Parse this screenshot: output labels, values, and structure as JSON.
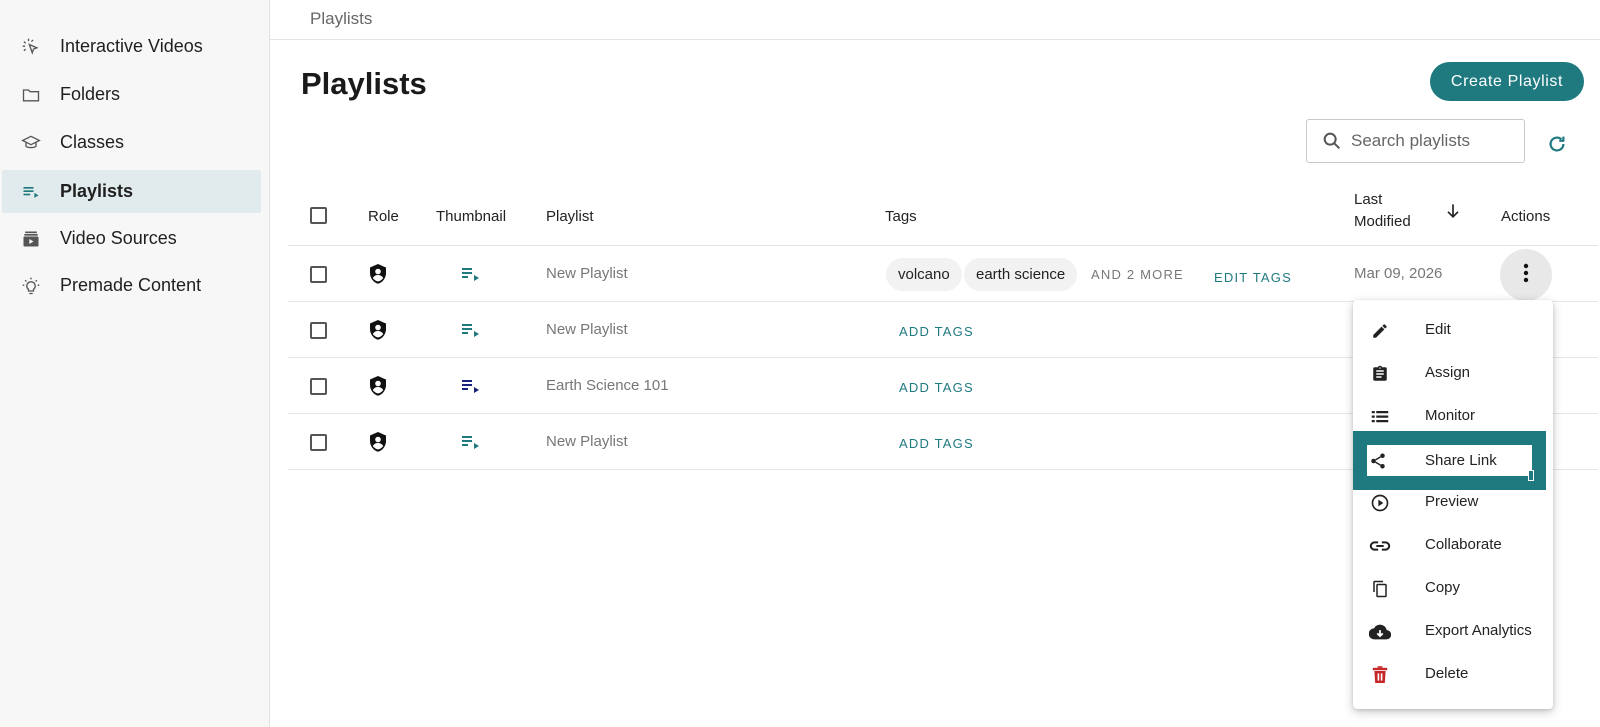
{
  "sidebar": {
    "items": [
      {
        "label": "Interactive Videos",
        "icon": "cursor-click-icon"
      },
      {
        "label": "Folders",
        "icon": "folder-icon"
      },
      {
        "label": "Classes",
        "icon": "graduation-cap-icon"
      },
      {
        "label": "Playlists",
        "icon": "playlist-icon",
        "active": true
      },
      {
        "label": "Video Sources",
        "icon": "video-library-icon"
      },
      {
        "label": "Premade Content",
        "icon": "lightbulb-icon"
      }
    ]
  },
  "breadcrumb": "Playlists",
  "page_title": "Playlists",
  "create_button": "Create Playlist",
  "search": {
    "placeholder": "Search playlists"
  },
  "table": {
    "headers": {
      "role": "Role",
      "thumbnail": "Thumbnail",
      "playlist": "Playlist",
      "tags": "Tags",
      "last_modified_1": "Last",
      "last_modified_2": "Modified",
      "actions": "Actions"
    },
    "rows": [
      {
        "name": "New Playlist",
        "tags": [
          "volcano",
          "earth science"
        ],
        "more": "AND 2 MORE",
        "tag_action": "EDIT TAGS",
        "modified": "Mar 09, 2026"
      },
      {
        "name": "New Playlist",
        "tag_action": "ADD TAGS"
      },
      {
        "name": "Earth Science 101",
        "tag_action": "ADD TAGS"
      },
      {
        "name": "New Playlist",
        "tag_action": "ADD TAGS"
      }
    ]
  },
  "menu": {
    "items": [
      {
        "label": "Edit",
        "icon": "pencil-icon"
      },
      {
        "label": "Assign",
        "icon": "clipboard-icon"
      },
      {
        "label": "Monitor",
        "icon": "list-icon"
      },
      {
        "label": "Share Link",
        "icon": "share-icon"
      },
      {
        "label": "Preview",
        "icon": "play-circle-icon"
      },
      {
        "label": "Collaborate",
        "icon": "link-icon"
      },
      {
        "label": "Copy",
        "icon": "copy-icon"
      },
      {
        "label": "Export Analytics",
        "icon": "cloud-download-icon"
      },
      {
        "label": "Delete",
        "icon": "trash-icon"
      }
    ]
  },
  "colors": {
    "accent": "#1f7a80",
    "delete": "#c62828",
    "active_nav_bg": "#e1eaec"
  }
}
